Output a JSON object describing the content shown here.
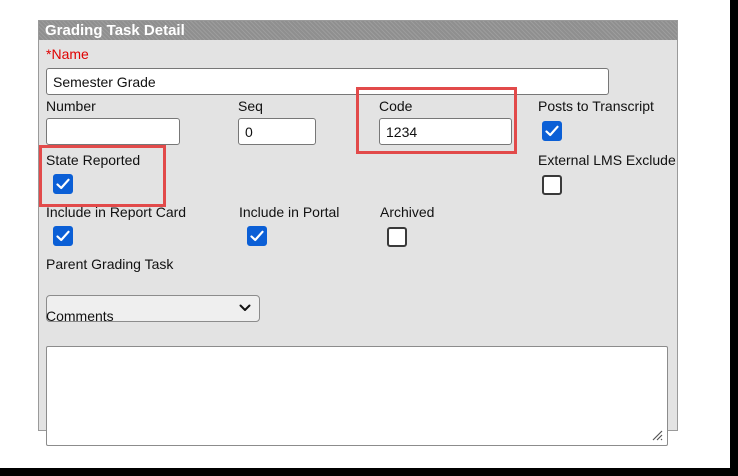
{
  "panel": {
    "title": "Grading Task Detail"
  },
  "fields": {
    "name": {
      "required_mark": "*",
      "label": "Name",
      "value": "Semester Grade"
    },
    "number": {
      "label": "Number",
      "value": ""
    },
    "seq": {
      "label": "Seq",
      "value": "0"
    },
    "code": {
      "label": "Code",
      "value": "1234"
    },
    "posts_to_transcript": {
      "label": "Posts to Transcript",
      "checked": true
    },
    "state_reported": {
      "label": "State Reported",
      "checked": true
    },
    "external_lms_exclude": {
      "label": "External LMS Exclude",
      "checked": false
    },
    "include_in_report_card": {
      "label": "Include in Report Card",
      "checked": true
    },
    "include_in_portal": {
      "label": "Include in Portal",
      "checked": true
    },
    "archived": {
      "label": "Archived",
      "checked": false
    },
    "parent_grading_task": {
      "label": "Parent Grading Task",
      "value": ""
    },
    "comments": {
      "label": "Comments",
      "value": ""
    }
  },
  "colors": {
    "checkbox_checked": "#0b5fd6",
    "highlight_box": "#e24a4a",
    "required_mark": "#e00000",
    "panel_header": "#8f8f8f"
  }
}
